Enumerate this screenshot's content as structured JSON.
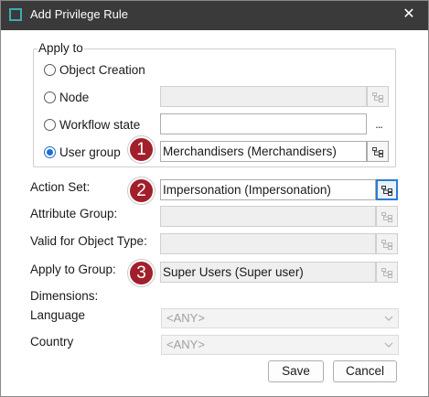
{
  "window": {
    "title": "Add Privilege Rule",
    "close_glyph": "✕"
  },
  "apply_to": {
    "legend": "Apply to",
    "options": [
      {
        "label": "Object Creation",
        "checked": false
      },
      {
        "label": "Node",
        "checked": false
      },
      {
        "label": "Workflow state",
        "checked": false
      },
      {
        "label": "User group",
        "checked": true
      }
    ],
    "node_value": "",
    "workflow_value": "",
    "workflow_button": "...",
    "user_group_value": "Merchandisers (Merchandisers)"
  },
  "form": {
    "action_set_label": "Action Set:",
    "action_set_value": "Impersonation (Impersonation)",
    "attribute_group_label": "Attribute Group:",
    "attribute_group_value": "",
    "valid_object_type_label": "Valid for Object Type:",
    "valid_object_type_value": "",
    "apply_to_group_label": "Apply to Group:",
    "apply_to_group_value": "Super Users (Super user)",
    "dimensions_label": "Dimensions:",
    "language_label": "Language",
    "language_value": "<ANY>",
    "country_label": "Country",
    "country_value": "<ANY>"
  },
  "badges": {
    "one": "1",
    "two": "2",
    "three": "3"
  },
  "buttons": {
    "save": "Save",
    "cancel": "Cancel"
  },
  "icons": {
    "tree_picker": "tree-picker-icon",
    "chevron": "chevron-down-icon",
    "app": "window-app-icon"
  },
  "colors": {
    "badge": "#a11f2b",
    "radio_selected": "#1f6fd1",
    "titlebar": "#3a3a3a",
    "focus_border": "#2d7ad6"
  }
}
